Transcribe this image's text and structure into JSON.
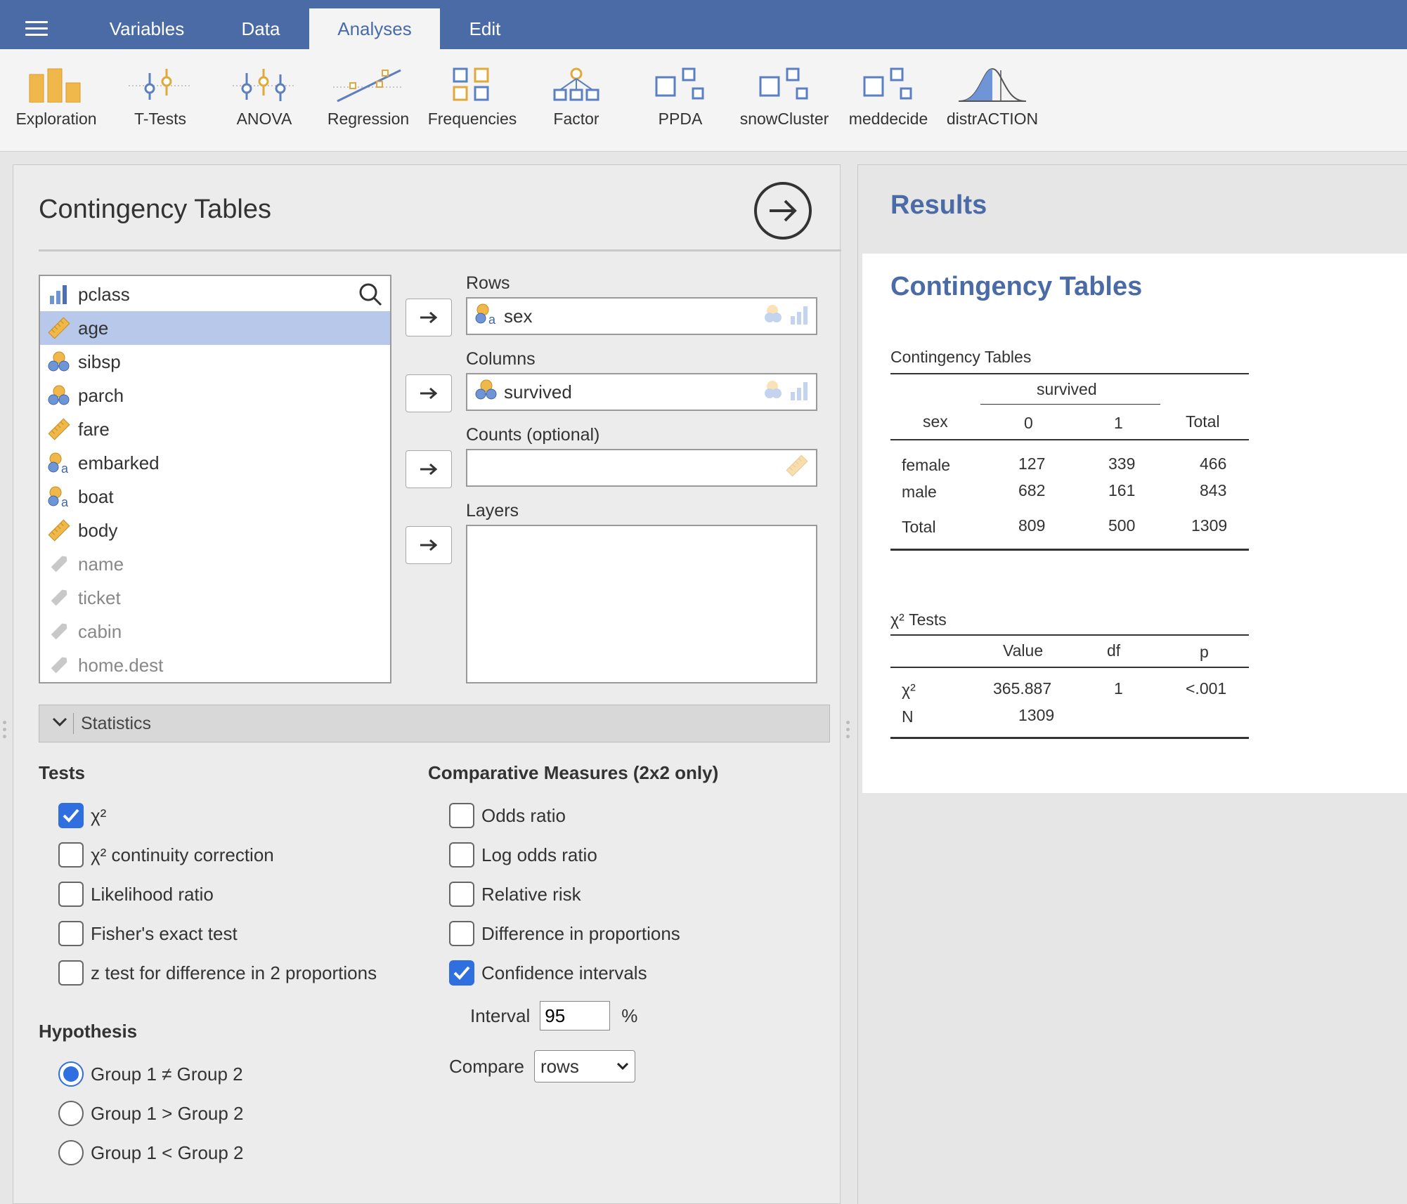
{
  "topbar": {
    "tabs": [
      "Variables",
      "Data",
      "Analyses",
      "Edit"
    ],
    "active_tab": "Analyses"
  },
  "toolbar": {
    "items": [
      {
        "label": "Exploration",
        "icon": "exploration-icon"
      },
      {
        "label": "T-Tests",
        "icon": "t-tests-icon"
      },
      {
        "label": "ANOVA",
        "icon": "anova-icon"
      },
      {
        "label": "Regression",
        "icon": "regression-icon"
      },
      {
        "label": "Frequencies",
        "icon": "frequencies-icon"
      },
      {
        "label": "Factor",
        "icon": "factor-icon"
      },
      {
        "label": "PPDA",
        "icon": "module-icon"
      },
      {
        "label": "snowCluster",
        "icon": "module-icon"
      },
      {
        "label": "meddecide",
        "icon": "module-icon"
      },
      {
        "label": "distrACTION",
        "icon": "distribution-icon"
      }
    ]
  },
  "analysis": {
    "title": "Contingency Tables",
    "variables": [
      {
        "name": "pclass",
        "type": "ordinal"
      },
      {
        "name": "age",
        "type": "continuous",
        "selected": true
      },
      {
        "name": "sibsp",
        "type": "nominal"
      },
      {
        "name": "parch",
        "type": "nominal"
      },
      {
        "name": "fare",
        "type": "continuous"
      },
      {
        "name": "embarked",
        "type": "nominal-text"
      },
      {
        "name": "boat",
        "type": "nominal-text"
      },
      {
        "name": "body",
        "type": "continuous"
      },
      {
        "name": "name",
        "type": "id"
      },
      {
        "name": "ticket",
        "type": "id"
      },
      {
        "name": "cabin",
        "type": "id"
      },
      {
        "name": "home.dest",
        "type": "id"
      }
    ],
    "rows_label": "Rows",
    "rows_value": "sex",
    "columns_label": "Columns",
    "columns_value": "survived",
    "counts_label": "Counts (optional)",
    "layers_label": "Layers",
    "statistics_label": "Statistics",
    "tests": {
      "title": "Tests",
      "options": [
        {
          "label": "χ²",
          "checked": true
        },
        {
          "label": "χ² continuity correction",
          "checked": false
        },
        {
          "label": "Likelihood ratio",
          "checked": false
        },
        {
          "label": "Fisher's exact test",
          "checked": false
        },
        {
          "label": "z test for difference in 2 proportions",
          "checked": false
        }
      ]
    },
    "comparative": {
      "title": "Comparative Measures (2x2 only)",
      "options": [
        {
          "label": "Odds ratio",
          "checked": false
        },
        {
          "label": "Log odds ratio",
          "checked": false
        },
        {
          "label": "Relative risk",
          "checked": false
        },
        {
          "label": "Difference in proportions",
          "checked": false
        },
        {
          "label": "Confidence intervals",
          "checked": true
        }
      ],
      "interval_label": "Interval",
      "interval_value": "95",
      "interval_unit": "%",
      "compare_label": "Compare",
      "compare_value": "rows"
    },
    "hypothesis": {
      "title": "Hypothesis",
      "options": [
        {
          "label": "Group 1 ≠ Group 2",
          "checked": true
        },
        {
          "label": "Group 1 > Group 2",
          "checked": false
        },
        {
          "label": "Group 1 < Group 2",
          "checked": false
        }
      ]
    }
  },
  "results": {
    "title": "Results",
    "heading": "Contingency Tables",
    "ct_table": {
      "title": "Contingency Tables",
      "super_header": "survived",
      "headers": [
        "sex",
        "0",
        "1",
        "Total"
      ],
      "rows": [
        [
          "female",
          "127",
          "339",
          "466"
        ],
        [
          "male",
          "682",
          "161",
          "843"
        ]
      ],
      "total_row": [
        "Total",
        "809",
        "500",
        "1309"
      ]
    },
    "chi_table": {
      "title": "χ² Tests",
      "headers": [
        "",
        "Value",
        "df",
        "p"
      ],
      "rows": [
        [
          "χ²",
          "365.887",
          "1",
          "<.001"
        ],
        [
          "N",
          "1309",
          "",
          ""
        ]
      ]
    }
  },
  "colors": {
    "brand": "#4a6ba5",
    "checkbox": "#2f6fe0",
    "selected_row": "#b7c8ea"
  }
}
